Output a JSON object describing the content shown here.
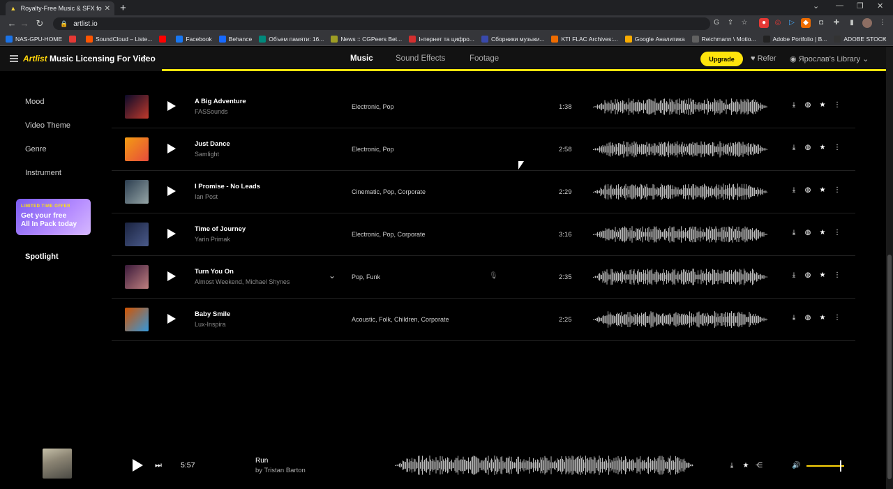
{
  "browser": {
    "tab_title": "Royalty-Free Music & SFX for Video",
    "tab_close": "✕",
    "new_tab": "+",
    "url": "artlist.io",
    "bookmarks": [
      {
        "label": "NAS-GPU-HOME",
        "color": "#1a73e8"
      },
      {
        "label": "",
        "color": "#e53935"
      },
      {
        "label": "SoundCloud – Liste...",
        "color": "#ff5500"
      },
      {
        "label": "",
        "color": "#ff0000"
      },
      {
        "label": "Facebook",
        "color": "#1877f2"
      },
      {
        "label": "Behance",
        "color": "#1769ff"
      },
      {
        "label": "Объем памяти: 16...",
        "color": "#00897b"
      },
      {
        "label": "News :: CGPeers Bet...",
        "color": "#9e9d24"
      },
      {
        "label": "Інтернет та цифро...",
        "color": "#d32f2f"
      },
      {
        "label": "Сборники музыки...",
        "color": "#3949ab"
      },
      {
        "label": "KTI FLAC Archives:...",
        "color": "#ef6c00"
      },
      {
        "label": "Google Аналитика",
        "color": "#f9ab00"
      },
      {
        "label": "Reichmann \\ Motio...",
        "color": "#616161"
      },
      {
        "label": "Adobe Portfolio | B...",
        "color": "#222222"
      },
      {
        "label": "ADOBE STOCK",
        "color": "#333333"
      }
    ],
    "bookmarks_more": "»"
  },
  "header": {
    "logo": "Artlist",
    "title": "Music Licensing For Video",
    "nav": [
      "Music",
      "Sound Effects",
      "Footage"
    ],
    "upgrade": "Upgrade",
    "refer": "Refer",
    "library": "Ярослав's Library"
  },
  "sidebar": {
    "items": [
      "Mood",
      "Video Theme",
      "Genre",
      "Instrument"
    ],
    "promo": {
      "tag": "LIMITED TIME OFFER",
      "line1": "Get your free",
      "line2": "All In Pack today"
    },
    "spotlight": "Spotlight"
  },
  "tracks": [
    {
      "title": "A Big Adventure",
      "artist": "FASSounds",
      "genres": "Electronic,  Pop",
      "duration": "1:38",
      "cover": [
        "#0a0a2a",
        "#c0392b"
      ]
    },
    {
      "title": "Just Dance",
      "artist": "Samlight",
      "genres": "Electronic,  Pop",
      "duration": "2:58",
      "cover": [
        "#f39c12",
        "#e74c3c"
      ]
    },
    {
      "title": "I Promise - No Leads",
      "artist": "Ian Post",
      "genres": "Cinematic,  Pop,  Corporate",
      "duration": "2:29",
      "cover": [
        "#2c3e50",
        "#95a5a6"
      ]
    },
    {
      "title": "Time of Journey",
      "artist": "Yarin Primak",
      "genres": "Electronic,  Pop,  Corporate",
      "duration": "3:16",
      "cover": [
        "#1a2340",
        "#4a5a8a"
      ]
    },
    {
      "title": "Turn You On",
      "artist": "Almost Weekend, Michael Shynes",
      "genres": "Pop,  Funk",
      "duration": "2:35",
      "cover": [
        "#3a1a3a",
        "#c08080"
      ]
    },
    {
      "title": "Baby Smile",
      "artist": "Lux-Inspira",
      "genres": "Acoustic,  Folk,  Children,  Corporate",
      "duration": "2:25",
      "cover": [
        "#d35400",
        "#3498db"
      ]
    }
  ],
  "player": {
    "time": "5:57",
    "title": "Run",
    "artist": "by Tristan Barton"
  }
}
